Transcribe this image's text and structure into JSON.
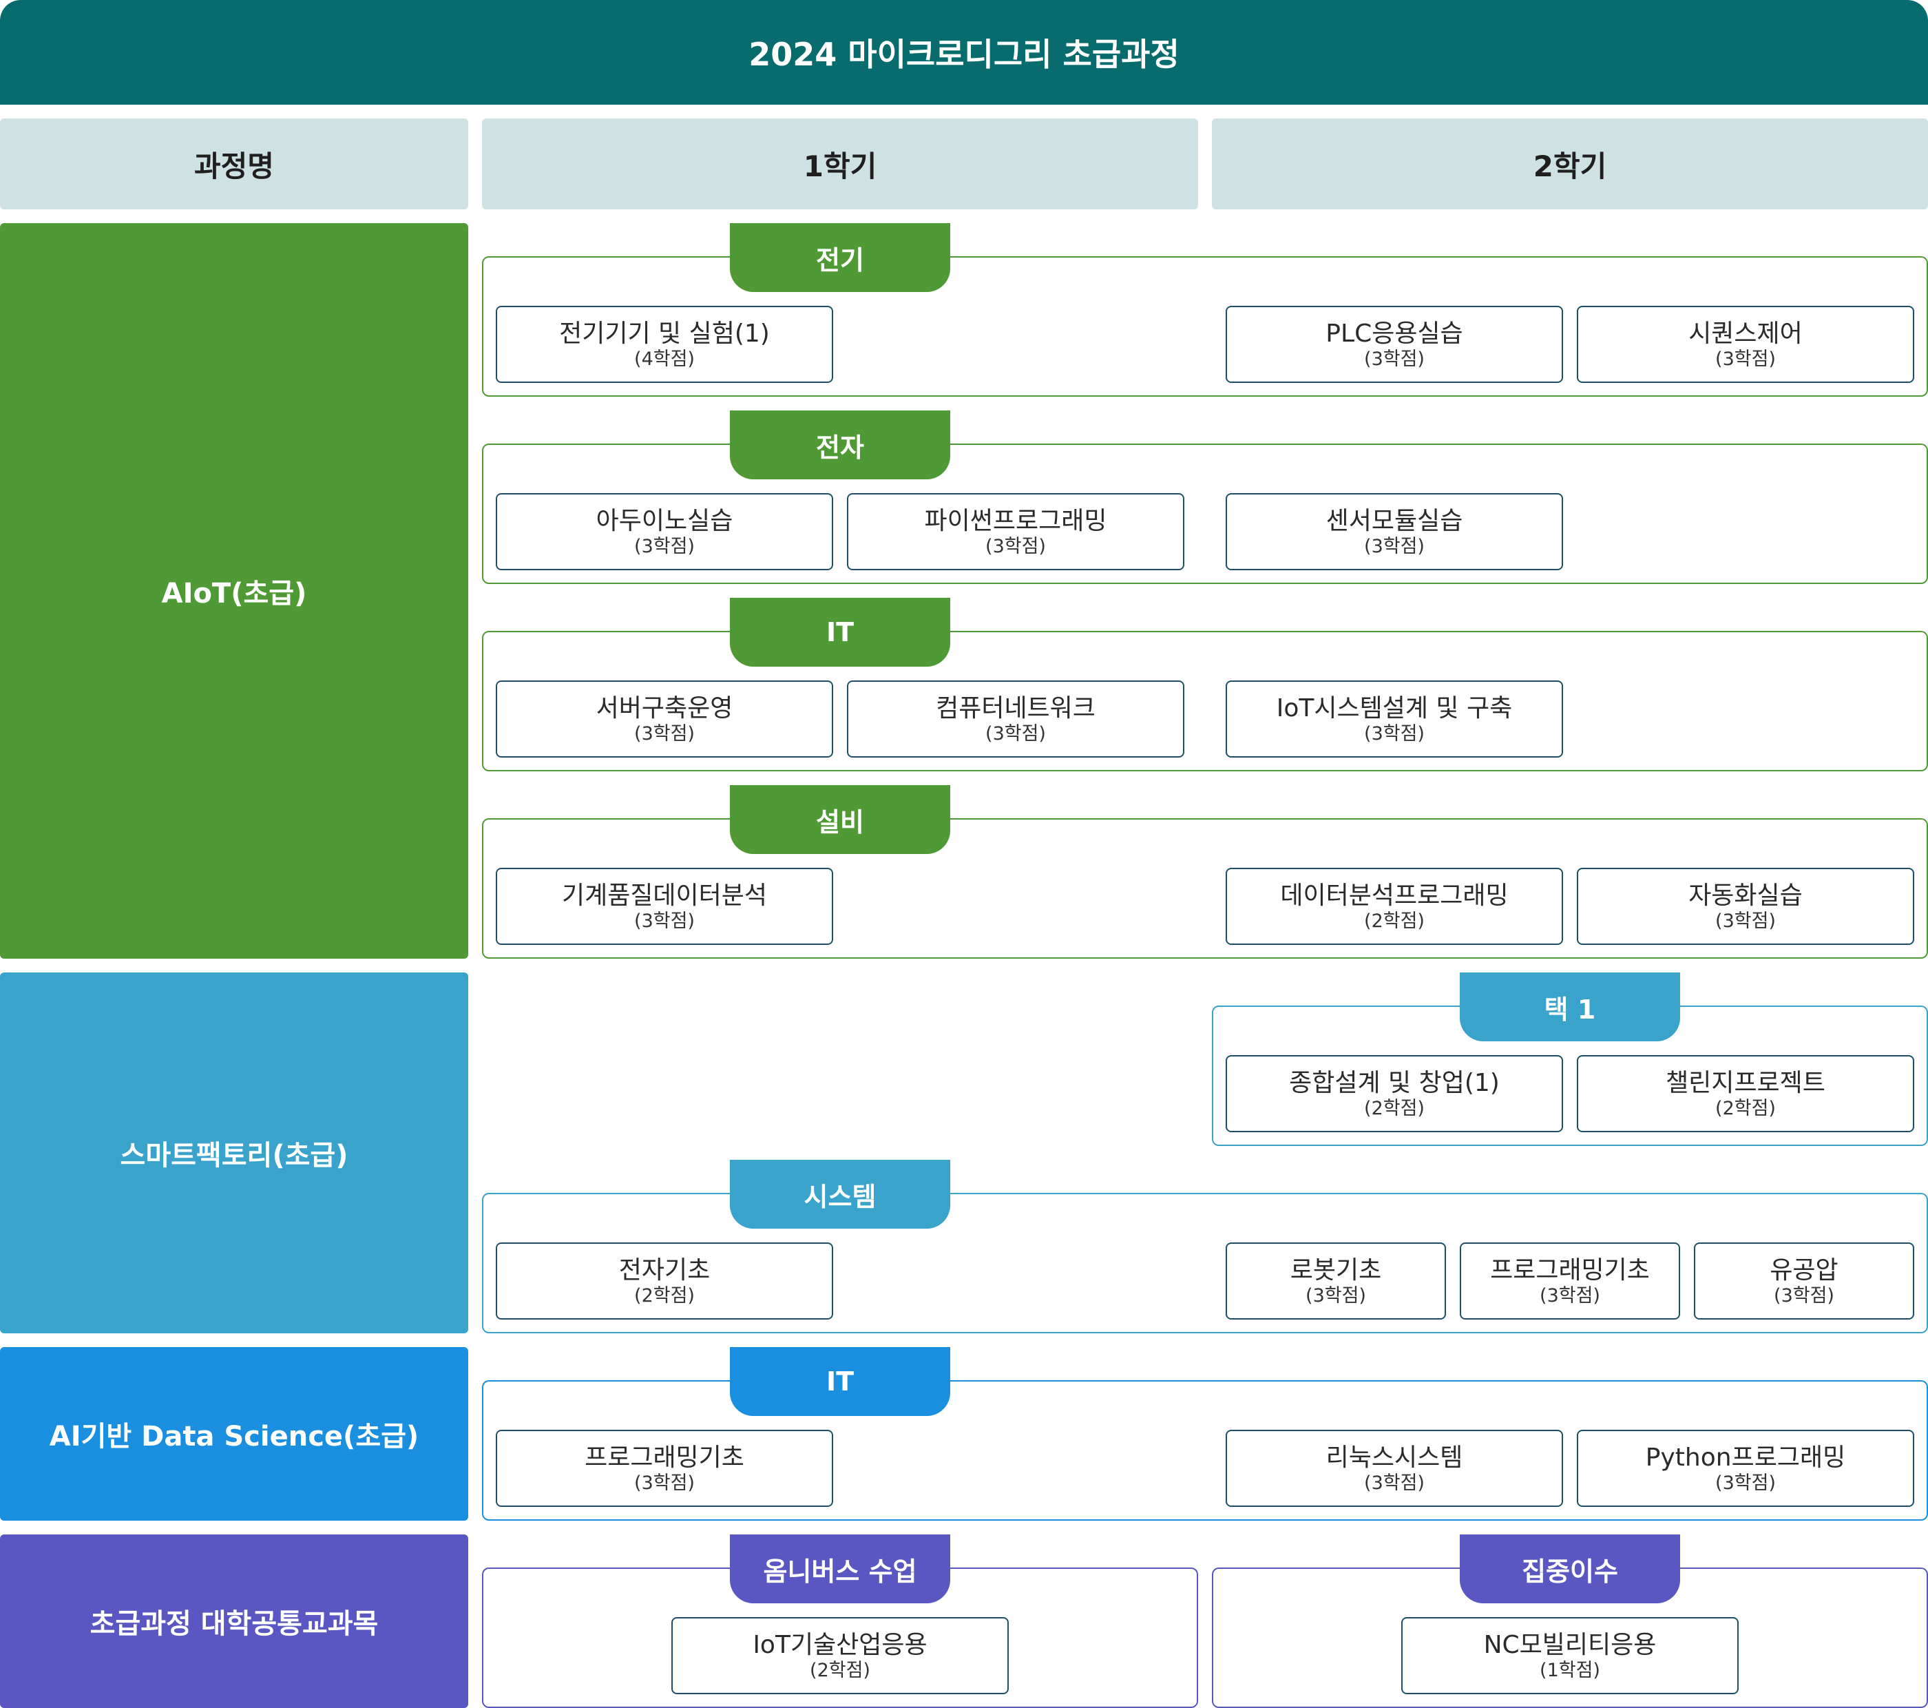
{
  "title": "2024 마이크로디그리 초급과정",
  "headers": {
    "course": "과정명",
    "sem1": "1학기",
    "sem2": "2학기"
  },
  "tracks": {
    "aiot": "AIoT(초급)",
    "smart_factory": "스마트팩토리(초급)",
    "ai_data_science": "AI기반 Data Science(초급)",
    "common": "초급과정 대학공통교과목"
  },
  "groups": {
    "electric": {
      "tab": "전기",
      "courses": [
        {
          "name": "전기기기 및 실험(1)",
          "credit": "(4학점)"
        },
        {
          "name": "PLC응용실습",
          "credit": "(3학점)"
        },
        {
          "name": "시퀀스제어",
          "credit": "(3학점)"
        }
      ]
    },
    "electronic": {
      "tab": "전자",
      "courses": [
        {
          "name": "아두이노실습",
          "credit": "(3학점)"
        },
        {
          "name": "파이썬프로그래밍",
          "credit": "(3학점)"
        },
        {
          "name": "센서모듈실습",
          "credit": "(3학점)"
        }
      ]
    },
    "it": {
      "tab": "IT",
      "courses": [
        {
          "name": "서버구축운영",
          "credit": "(3학점)"
        },
        {
          "name": "컴퓨터네트워크",
          "credit": "(3학점)"
        },
        {
          "name": "IoT시스템설계 및 구축",
          "credit": "(3학점)"
        }
      ]
    },
    "facility": {
      "tab": "설비",
      "courses": [
        {
          "name": "기계품질데이터분석",
          "credit": "(3학점)"
        },
        {
          "name": "데이터분석프로그래밍",
          "credit": "(2학점)"
        },
        {
          "name": "자동화실습",
          "credit": "(3학점)"
        }
      ]
    },
    "elective": {
      "tab": "택 1",
      "courses": [
        {
          "name": "종합설계 및 창업(1)",
          "credit": "(2학점)"
        },
        {
          "name": "챌린지프로젝트",
          "credit": "(2학점)"
        }
      ]
    },
    "system": {
      "tab": "시스템",
      "courses": [
        {
          "name": "전자기초",
          "credit": "(2학점)"
        },
        {
          "name": "로봇기초",
          "credit": "(3학점)"
        },
        {
          "name": "프로그래밍기초",
          "credit": "(3학점)"
        },
        {
          "name": "유공압",
          "credit": "(3학점)"
        }
      ]
    },
    "ds_it": {
      "tab": "IT",
      "courses": [
        {
          "name": "프로그래밍기초",
          "credit": "(3학점)"
        },
        {
          "name": "리눅스시스템",
          "credit": "(3학점)"
        },
        {
          "name": "Python프로그래밍",
          "credit": "(3학점)"
        }
      ]
    },
    "omnibus": {
      "tab": "옴니버스 수업",
      "courses": [
        {
          "name": "IoT기술산업응용",
          "credit": "(2학점)"
        }
      ]
    },
    "intensive": {
      "tab": "집중이수",
      "courses": [
        {
          "name": "NC모빌리티응용",
          "credit": "(1학점)"
        }
      ]
    }
  },
  "colors": {
    "title_bg": "#086b6d",
    "header_bg": "#cfe2e3",
    "aiot": "#4f9a35",
    "smart_factory": "#3aa3cb",
    "ai_data_science": "#1a8fe0",
    "common": "#5b57c2",
    "course_border": "#1e4e66"
  }
}
